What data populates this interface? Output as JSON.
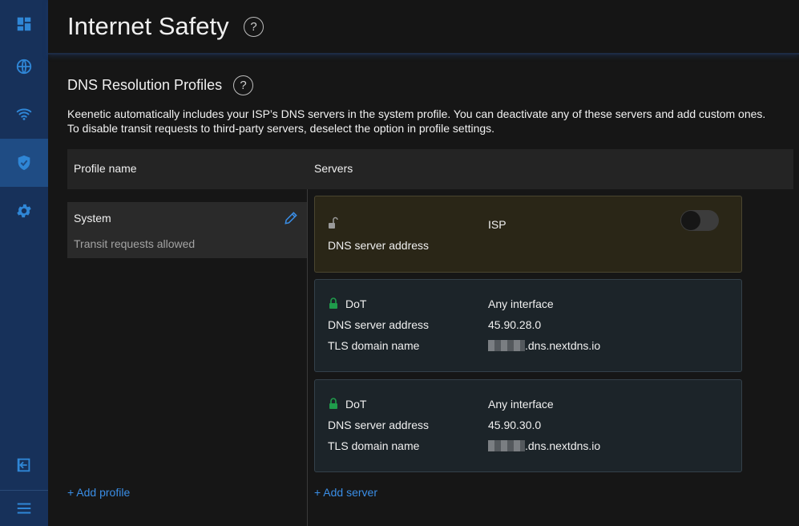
{
  "header": {
    "title": "Internet Safety",
    "help": "?"
  },
  "section": {
    "title": "DNS Resolution Profiles",
    "help": "?",
    "description_line1": "Keenetic automatically includes your ISP’s DNS servers in the system profile. You can deactivate any of these servers and add custom ones.",
    "description_line2": "To disable transit requests to third-party servers, deselect the option in profile settings."
  },
  "table": {
    "col_profile": "Profile name",
    "col_servers": "Servers"
  },
  "profiles": [
    {
      "name": "System",
      "status": "Transit requests allowed"
    }
  ],
  "add_profile": "+ Add profile",
  "add_server": "+ Add server",
  "servers": [
    {
      "type": "ISP",
      "label_address": "DNS server address",
      "enabled": false
    },
    {
      "type": "DoT",
      "interface": "Any interface",
      "label_address": "DNS server address",
      "address": "45.90.28.0",
      "label_tls": "TLS domain name",
      "tls_suffix": ".dns.nextdns.io"
    },
    {
      "type": "DoT",
      "interface": "Any interface",
      "label_address": "DNS server address",
      "address": "45.90.30.0",
      "label_tls": "TLS domain name",
      "tls_suffix": ".dns.nextdns.io"
    }
  ],
  "icons": {
    "sidebar": [
      "dashboard-icon",
      "globe-icon",
      "wifi-icon",
      "shield-icon",
      "gear-icon",
      "logout-icon",
      "menu-icon"
    ],
    "lock_open_color": "#9a9a9a",
    "lock_closed_color": "#1f9c4b",
    "accent": "#3a8ee6"
  }
}
